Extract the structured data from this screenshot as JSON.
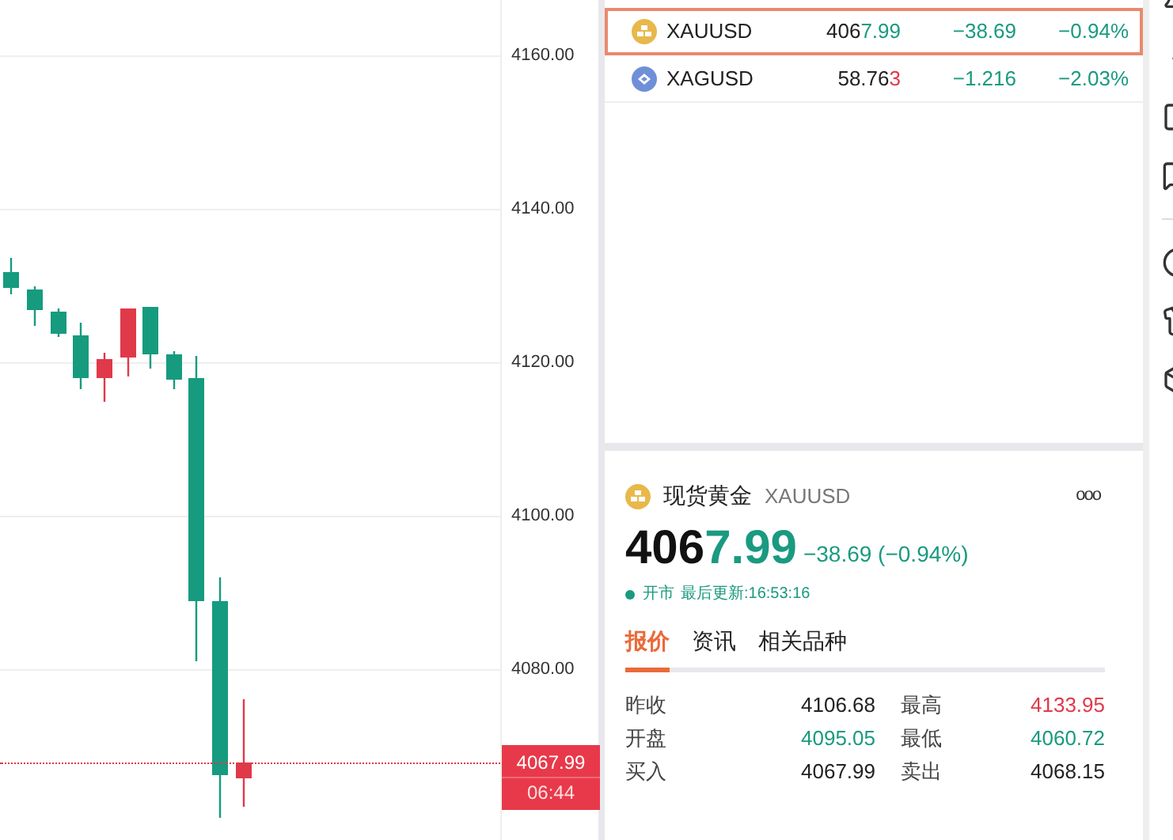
{
  "chart": {
    "y_axis": [
      "4160.00",
      "4140.00",
      "4120.00",
      "4100.00",
      "4080.00"
    ],
    "price_tag": {
      "price": "4067.99",
      "countdown": "06:44"
    }
  },
  "watchlist": [
    {
      "symbol": "XAUUSD",
      "kind": "gold",
      "selected": true,
      "price": [
        {
          "text": "406",
          "color": "#222222"
        },
        {
          "text": "7.99",
          "color": "#1a9a80"
        }
      ],
      "change": "−38.69",
      "color": "#1a9a80",
      "percent": "−0.94%"
    },
    {
      "symbol": "XAGUSD",
      "kind": "silver",
      "selected": false,
      "price": [
        {
          "text": "58.76",
          "color": "#222222"
        },
        {
          "text": "3",
          "color": "#e0394a"
        }
      ],
      "change": "−1.216",
      "color": "#1a9a80",
      "percent": "−2.03%"
    }
  ],
  "detail": {
    "name": "现货黄金",
    "symbol": "XAUUSD",
    "more": "ooo",
    "price": [
      {
        "text": "406",
        "color": "#111111"
      },
      {
        "text": "7.99",
        "color": "#1a9a80"
      }
    ],
    "change": "−38.69 (−0.94%)",
    "color": "#1a9a80",
    "market_open": true,
    "status": "开市",
    "updated": "最后更新:16:53:16",
    "tabs": [
      {
        "label": "报价",
        "selected": true
      },
      {
        "label": "资讯",
        "selected": false
      },
      {
        "label": "相关品种",
        "selected": false
      }
    ],
    "stats": [
      {
        "label": "昨收",
        "value": "4106.68",
        "color": "#222222"
      },
      {
        "label": "最高",
        "value": "4133.95",
        "color": "#e0394a"
      },
      {
        "label": "开盘",
        "value": "4095.05",
        "color": "#1a9a80"
      },
      {
        "label": "最低",
        "value": "4060.72",
        "color": "#1a9a80"
      },
      {
        "label": "买入",
        "value": "4067.99",
        "color": "#222222"
      },
      {
        "label": "卖出",
        "value": "4068.15",
        "color": "#222222"
      }
    ]
  }
}
